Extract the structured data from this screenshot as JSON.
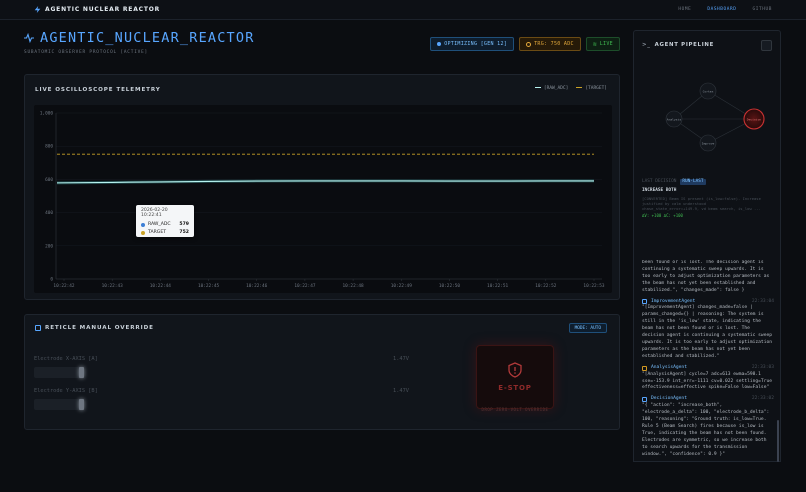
{
  "nav": {
    "brand": "AGENTIC NUCLEAR REACTOR",
    "links": [
      "HOME",
      "DASHBOARD",
      "GITHUB"
    ],
    "active_index": 1
  },
  "header": {
    "title": "AGENTIC_NUCLEAR_REACTOR",
    "subtitle": "SUBATOMIC OBSERVER PROTOCOL [ACTIVE]",
    "badges": {
      "optimizing": "OPTIMIZING [GEN 12]",
      "target": "TRG: 750 ADC",
      "live": "LIVE"
    }
  },
  "scope": {
    "title": "LIVE OSCILLOSCOPE TELEMETRY",
    "legend_raw": "[RAW_ADC]",
    "legend_target": "[TARGET]",
    "tooltip": {
      "time": "2026-02-20 10:22:41",
      "raw_label": "RAW_ADC",
      "raw_value": "579",
      "target_label": "TARGET",
      "target_value": "752"
    }
  },
  "chart_data": {
    "type": "line",
    "title": "LIVE OSCILLOSCOPE TELEMETRY",
    "xlabel": "",
    "ylabel": "",
    "x": [
      "10:22:42",
      "10:22:43",
      "10:22:44",
      "10:22:45",
      "10:22:46",
      "10:22:47",
      "10:22:48",
      "10:22:49",
      "10:22:50",
      "10:22:51",
      "10:22:52",
      "10:22:53"
    ],
    "y_ticks": [
      "0",
      "200",
      "400",
      "600",
      "800",
      "1,000"
    ],
    "ylim": [
      0,
      1000
    ],
    "series": [
      {
        "name": "[RAW_ADC]",
        "values": [
          579,
          582,
          585,
          588,
          590,
          591,
          591,
          591,
          590,
          590,
          591,
          591
        ]
      },
      {
        "name": "[TARGET]",
        "values": [
          752,
          752,
          752,
          752,
          752,
          752,
          752,
          752,
          752,
          752,
          752,
          752
        ]
      }
    ],
    "grid": true,
    "legend": "top-right",
    "colors": {
      "raw": "#b7f3f0",
      "target": "#c9a227"
    }
  },
  "override": {
    "title": "RETICLE MANUAL OVERRIDE",
    "mode": "MODE: AUTO",
    "sliders": [
      {
        "label": "Electrode X-AXIS [A]",
        "value": "1.47V"
      },
      {
        "label": "Electrode Y-AXIS [B]",
        "value": "1.47V"
      }
    ],
    "estop_label": "E-STOP",
    "estop_note": "DROP ZERO-VOLT OVERRIDE"
  },
  "pipeline": {
    "title": "AGENT PIPELINE",
    "nodes": [
      "Cortex",
      "Analysis",
      "Improve",
      "Decision"
    ],
    "last_decision_label": "LAST DECISION",
    "last_decision_tag": "RUN-LAST",
    "decision": "INCREASE BOTH",
    "decision_reason": "[CONVERTED] Beam IS present (is_low=false). Increase justified by calm understood",
    "decision_meta": "chase_state_error=+149.9, vd beam search, is_low ...",
    "delta": "ΔV: +100   ΔC: +100",
    "logs": [
      {
        "type": "text",
        "body": "been found or is lost. The decision agent is continuing a systematic sweep upwards. It is too early to adjust optimization parameters as the beam has not yet been established and stabilized.\", \"changes_made\": false }"
      },
      {
        "type": "entry",
        "agent": "ImprovementAgent",
        "time": "22:33:04",
        "color": "#58a6ff",
        "body": "\"[ImprovementAgent] changes_made=false | params_changed={} | reasoning: The system is still in the 'is_low' state, indicating the beam has not been found or is lost. The decision agent is continuing a systematic sweep upwards. It is too early to adjust optimization parameters as the beam has not yet been established and stabilized.\""
      },
      {
        "type": "entry",
        "agent": "AnalysisAgent",
        "time": "22:33:03",
        "color": "#d29922",
        "body": "\"[AnalysisAgent] cycle=7 adc=613 ewma=598.1 sse=-153.9 int_err=-1111 cv=0.022 settling=True effectiveness=effective spike=False low=False\""
      },
      {
        "type": "entry",
        "agent": "DecisionAgent",
        "time": "22:33:02",
        "color": "#58a6ff",
        "body": "\"{ \"action\": \"increase_both\", \"electrode_a_delta\": 100, \"electrode_b_delta\": 100, \"reasoning\": \"Ground truth: is_low=True. Rule 5 (Beam Search) fires because is_low is True, indicating the beam has not been found. Electrodes are symmetric, so we increase both to search upwards for the transmission window.\", \"confidence\": 0.9 }\""
      }
    ]
  }
}
